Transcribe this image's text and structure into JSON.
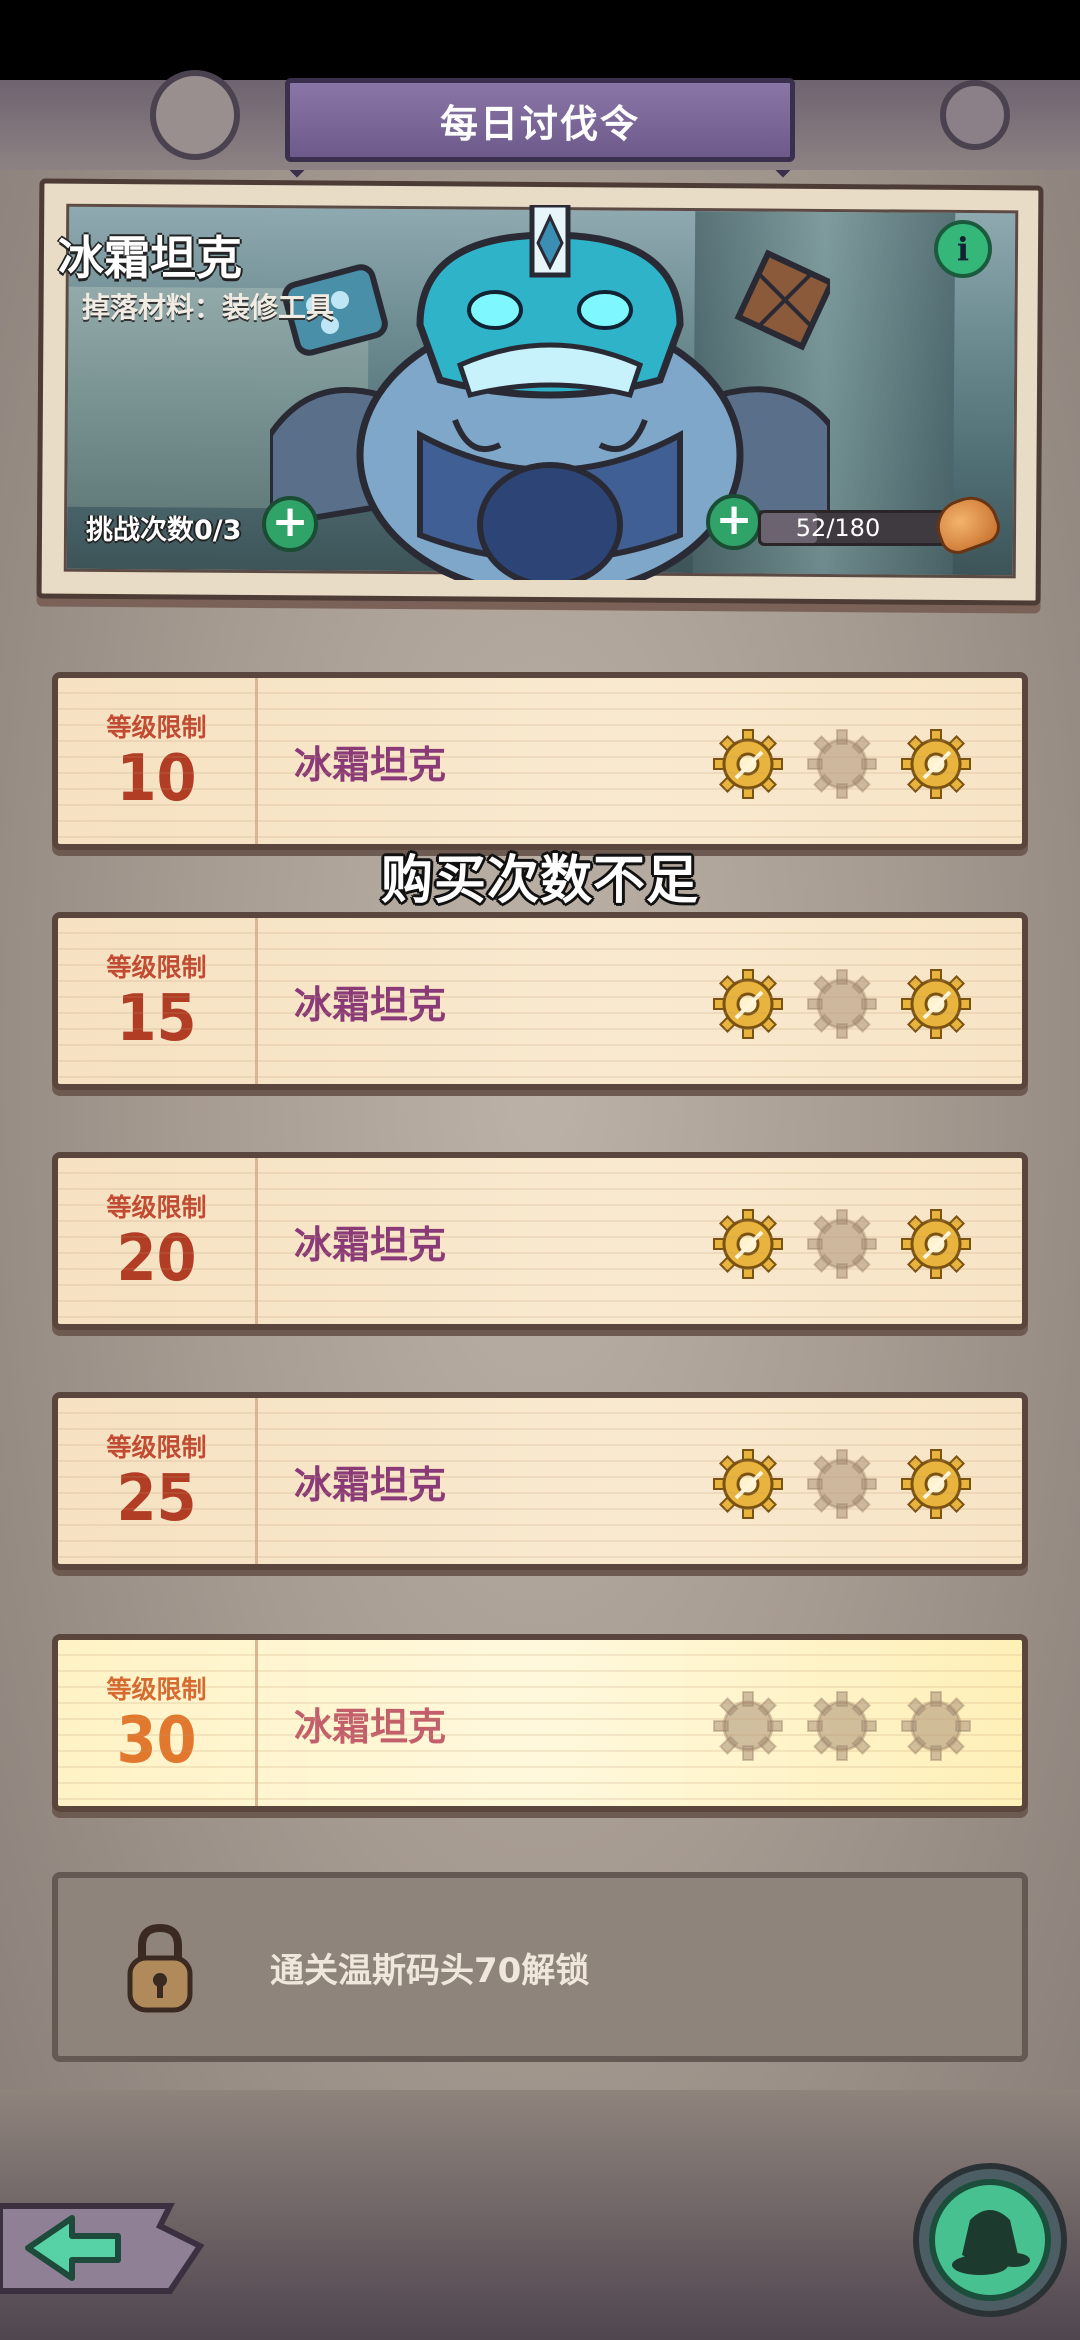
{
  "header": {
    "title": "每日讨伐令"
  },
  "boss": {
    "name": "冰霜坦克",
    "drop_text": "掉落材料：装修工具",
    "challenge_text": "挑战次数0/3",
    "stamina_text": "52/180",
    "stamina_fraction": 0.289
  },
  "stages": [
    {
      "level_label": "等级限制",
      "level": "10",
      "name": "冰霜坦克",
      "gears": [
        1,
        0,
        1
      ],
      "highlight": false
    },
    {
      "level_label": "等级限制",
      "level": "15",
      "name": "冰霜坦克",
      "gears": [
        1,
        0,
        1
      ],
      "highlight": false
    },
    {
      "level_label": "等级限制",
      "level": "20",
      "name": "冰霜坦克",
      "gears": [
        1,
        0,
        1
      ],
      "highlight": false
    },
    {
      "level_label": "等级限制",
      "level": "25",
      "name": "冰霜坦克",
      "gears": [
        1,
        0,
        1
      ],
      "highlight": false
    },
    {
      "level_label": "等级限制",
      "level": "30",
      "name": "冰霜坦克",
      "gears": [
        0,
        0,
        0
      ],
      "highlight": true
    }
  ],
  "locked": {
    "text": "通关温斯码头70解锁"
  },
  "toast": "购买次数不足",
  "icons": {
    "info": "info-icon",
    "plus": "plus-icon",
    "bread": "bread-icon",
    "gear_earned": "gear-icon",
    "gear_empty": "gear-empty-icon",
    "lock": "lock-icon",
    "back": "back-arrow-icon",
    "action": "coin-bag-icon"
  },
  "colors": {
    "banner": "#7a6696",
    "level_red": "#b13d24",
    "stage_name": "#8a3a76",
    "plus_green": "#2fa368",
    "gear_gold": "#e9b43e"
  }
}
